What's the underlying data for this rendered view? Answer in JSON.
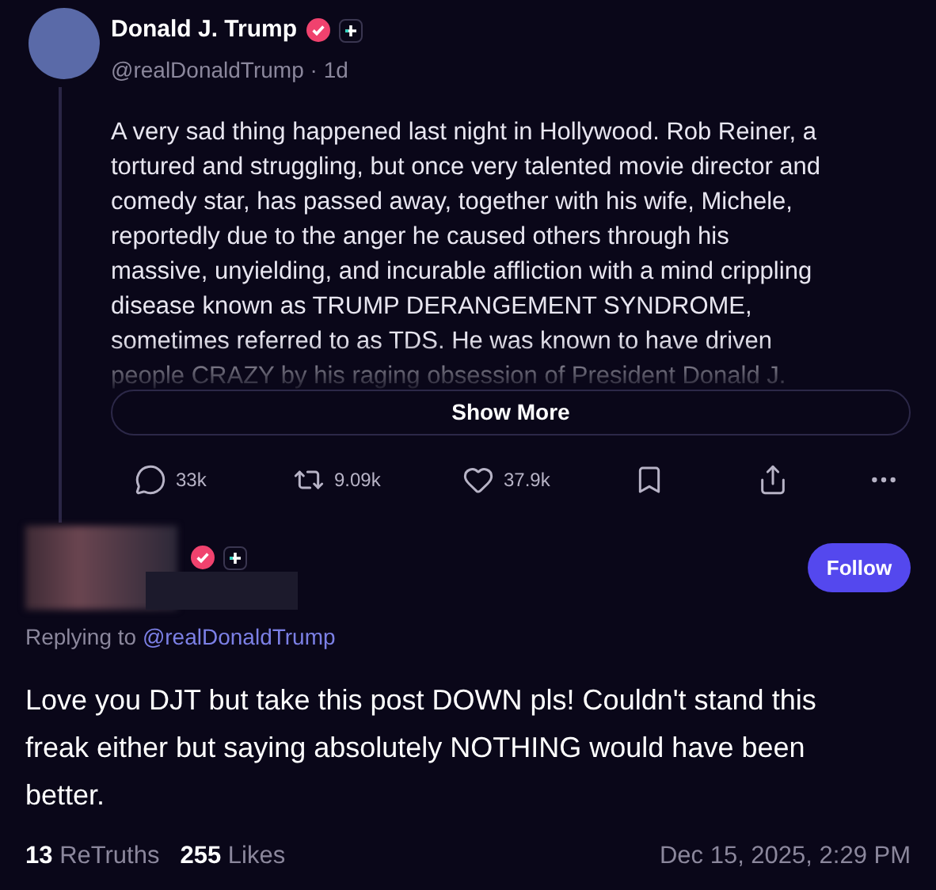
{
  "post": {
    "author": "Donald J. Trump",
    "verified": true,
    "handle": "@realDonaldTrump",
    "separator": "·",
    "time": "1d",
    "lines": [
      "A very sad thing happened last night in Hollywood. Rob Reiner, a",
      "tortured and struggling, but once very talented movie director and",
      "comedy star, has passed away, together with his wife, Michele,",
      "reportedly due to the anger he caused others through his",
      "massive, unyielding, and incurable affliction with a mind crippling",
      "disease known as TRUMP DERANGEMENT SYNDROME,",
      "sometimes referred to as TDS. He was known to have driven",
      "people CRAZY by his raging obsession of President Donald J."
    ],
    "show_more": "Show More",
    "actions": [
      {
        "kind": "reply",
        "count": "33k"
      },
      {
        "kind": "repost",
        "count": "9.09k"
      },
      {
        "kind": "like",
        "count": "37.9k"
      },
      {
        "kind": "bookmark"
      },
      {
        "kind": "share"
      },
      {
        "kind": "more"
      }
    ]
  },
  "reply": {
    "verified": true,
    "follow": "Follow",
    "replying_prefix": "Replying to",
    "replying_handle": "@realDonaldTrump",
    "lines": [
      "Love you DJT but take this post DOWN pls! Couldn't stand this",
      "freak either but saying absolutely NOTHING would have been",
      "better."
    ],
    "retruths": "13",
    "retruths_label": "ReTruths",
    "likes": "255",
    "likes_label": "Likes",
    "date": "Dec 15, 2025, 2:29 PM"
  }
}
